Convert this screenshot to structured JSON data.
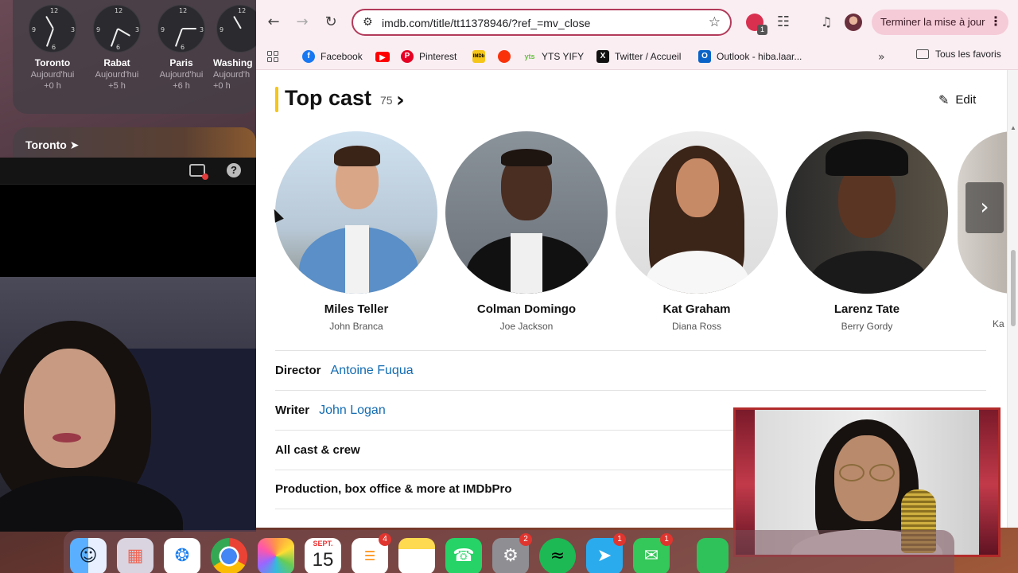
{
  "clocks": [
    {
      "city": "Toronto",
      "day": "Aujourd'hui",
      "offset": "+0 h"
    },
    {
      "city": "Rabat",
      "day": "Aujourd'hui",
      "offset": "+5 h"
    },
    {
      "city": "Paris",
      "day": "Aujourd'hui",
      "offset": "+6 h"
    },
    {
      "city": "Washing",
      "day": "Aujourd'h",
      "offset": "+0 h"
    }
  ],
  "weather": {
    "location": "Toronto ➤"
  },
  "browser": {
    "url": "imdb.com/title/tt11378946/?ref_=mv_close",
    "extension_badge": "1",
    "update_button": "Terminer la mise à jour",
    "bookmarks": [
      "Facebook",
      "Pinterest",
      "YTS YIFY",
      "Twitter / Accueil",
      "Outlook - hiba.laar..."
    ],
    "all_bookmarks": "Tous les favoris"
  },
  "imdb": {
    "section_title": "Top cast",
    "cast_count": "75",
    "edit_label": "Edit",
    "cast": [
      {
        "name": "Miles Teller",
        "role": "John Branca"
      },
      {
        "name": "Colman Domingo",
        "role": "Joe Jackson"
      },
      {
        "name": "Kat Graham",
        "role": "Diana Ross"
      },
      {
        "name": "Larenz Tate",
        "role": "Berry Gordy"
      }
    ],
    "partial_role": "Ka",
    "director_label": "Director",
    "director": "Antoine Fuqua",
    "writer_label": "Writer",
    "writer": "John Logan",
    "all_cast_label": "All cast & crew",
    "pro_label": "Production, box office & more at IMDbPro"
  },
  "dock": {
    "calendar_month": "SEPT.",
    "calendar_day": "15",
    "reminders_badge": "4",
    "settings_badge": "2",
    "telegram_badge": "1",
    "messages_badge": "1"
  },
  "colors": {
    "imdb_yellow": "#f5c518",
    "link_blue": "#136cb2",
    "omnibox_border": "#b23a5a",
    "update_button_bg": "#f5cbd8"
  }
}
